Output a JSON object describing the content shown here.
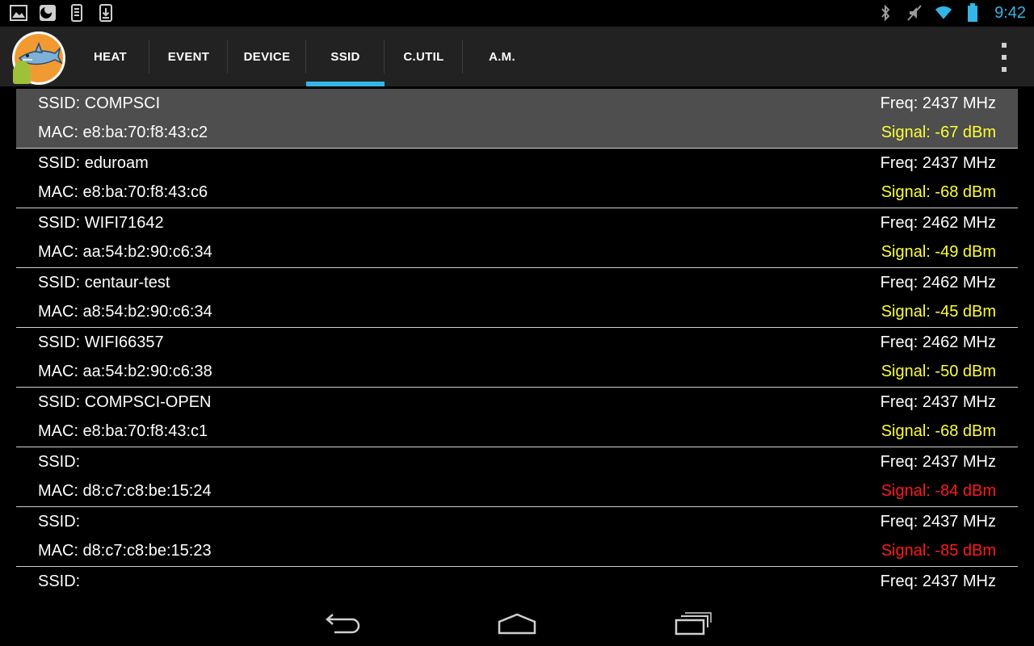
{
  "status_bar": {
    "time": "9:42",
    "left_icons": [
      "gallery-notification-icon",
      "sim-notification-icon",
      "phone-notification-icon",
      "download-notification-icon"
    ],
    "right_icons": [
      "bluetooth-icon",
      "mute-icon",
      "wifi-icon",
      "battery-icon"
    ]
  },
  "action_bar": {
    "logo": "shark-app-logo",
    "tabs": [
      {
        "label": "HEAT",
        "active": false
      },
      {
        "label": "EVENT",
        "active": false
      },
      {
        "label": "DEVICE",
        "active": false
      },
      {
        "label": "SSID",
        "active": true
      },
      {
        "label": "C.UTIL",
        "active": false
      },
      {
        "label": "A.M.",
        "active": false
      }
    ],
    "overflow_icon": "overflow-menu-icon"
  },
  "colors": {
    "accent": "#33b5e5",
    "signal_good": "#ffff33",
    "signal_weak": "#ff1a1a",
    "selected_row": "#4e4e4e"
  },
  "networks": [
    {
      "ssid": "SSID: COMPSCI",
      "freq": "Freq: 2437 MHz",
      "mac": "MAC: e8:ba:70:f8:43:c2",
      "signal": "Signal: -67 dBm",
      "level": "good",
      "selected": true
    },
    {
      "ssid": "SSID: eduroam",
      "freq": "Freq: 2437 MHz",
      "mac": "MAC: e8:ba:70:f8:43:c6",
      "signal": "Signal: -68 dBm",
      "level": "good"
    },
    {
      "ssid": "SSID: WIFI71642",
      "freq": "Freq: 2462 MHz",
      "mac": "MAC: aa:54:b2:90:c6:34",
      "signal": "Signal: -49 dBm",
      "level": "good"
    },
    {
      "ssid": "SSID: centaur-test",
      "freq": "Freq: 2462 MHz",
      "mac": "MAC: a8:54:b2:90:c6:34",
      "signal": "Signal: -45 dBm",
      "level": "good"
    },
    {
      "ssid": "SSID: WIFI66357",
      "freq": "Freq: 2462 MHz",
      "mac": "MAC: aa:54:b2:90:c6:38",
      "signal": "Signal: -50 dBm",
      "level": "good"
    },
    {
      "ssid": "SSID: COMPSCI-OPEN",
      "freq": "Freq: 2437 MHz",
      "mac": "MAC: e8:ba:70:f8:43:c1",
      "signal": "Signal: -68 dBm",
      "level": "good"
    },
    {
      "ssid": "SSID:",
      "freq": "Freq: 2437 MHz",
      "mac": "MAC: d8:c7:c8:be:15:24",
      "signal": "Signal: -84 dBm",
      "level": "weak"
    },
    {
      "ssid": "SSID:",
      "freq": "Freq: 2437 MHz",
      "mac": "MAC: d8:c7:c8:be:15:23",
      "signal": "Signal: -85 dBm",
      "level": "weak"
    },
    {
      "ssid": "SSID:",
      "freq": "Freq: 2437 MHz",
      "mac": "",
      "signal": "",
      "level": "good"
    }
  ],
  "nav_bar": {
    "buttons": [
      "back-icon",
      "home-icon",
      "recent-apps-icon"
    ]
  }
}
